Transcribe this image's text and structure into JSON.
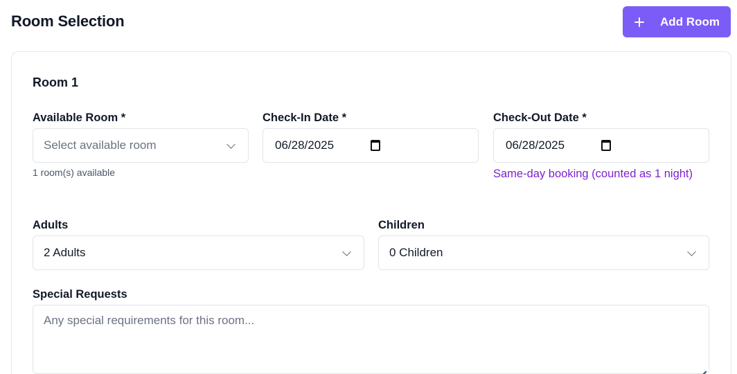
{
  "header": {
    "title": "Room Selection",
    "add_room_label": "Add Room"
  },
  "room": {
    "title": "Room 1",
    "available_room": {
      "label": "Available Room *",
      "placeholder": "Select available room",
      "hint": "1 room(s) available"
    },
    "check_in": {
      "label": "Check-In Date *",
      "value": "06/28/2025"
    },
    "check_out": {
      "label": "Check-Out Date *",
      "value": "06/28/2025",
      "note": "Same-day booking (counted as 1 night)"
    },
    "adults": {
      "label": "Adults",
      "value": "2 Adults"
    },
    "children": {
      "label": "Children",
      "value": "0 Children"
    },
    "special_requests": {
      "label": "Special Requests",
      "placeholder": "Any special requirements for this room..."
    }
  },
  "colors": {
    "accent": "#7c5cf6",
    "note": "#7e22ce"
  },
  "icons": {
    "add": "plus-icon",
    "select": "chevron-down-icon",
    "date": "calendar-icon",
    "resize": "resize-handle-icon"
  }
}
